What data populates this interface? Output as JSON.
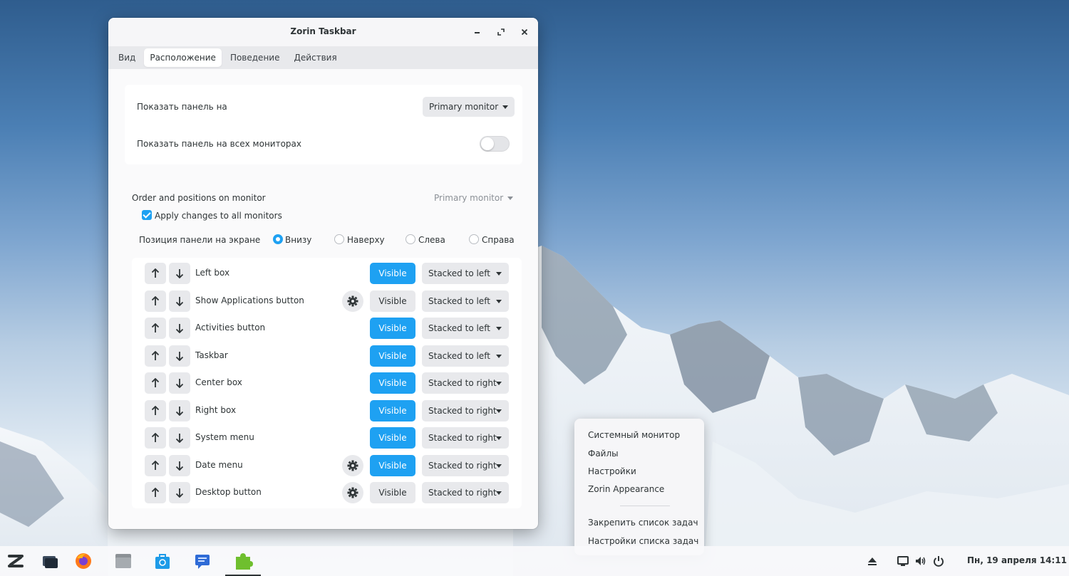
{
  "window": {
    "title": "Zorin Taskbar",
    "controls": [
      "minimize",
      "maximize",
      "close"
    ],
    "tabs": [
      {
        "label": "Вид",
        "active": false
      },
      {
        "label": "Расположение",
        "active": true
      },
      {
        "label": "Поведение",
        "active": false
      },
      {
        "label": "Действия",
        "active": false
      }
    ]
  },
  "display": {
    "show_panel_label": "Показать панель на",
    "show_panel_value": "Primary monitor",
    "all_monitors_label": "Показать панель на всех мониторах",
    "all_monitors_on": false
  },
  "order": {
    "heading": "Order and positions on monitor",
    "monitor_value": "Primary monitor",
    "apply_all_label": "Apply changes to all monitors",
    "apply_all_checked": true,
    "position_label": "Позиция панели на экране",
    "positions": [
      {
        "label": "Внизу",
        "selected": true
      },
      {
        "label": "Наверху",
        "selected": false
      },
      {
        "label": "Слева",
        "selected": false
      },
      {
        "label": "Справа",
        "selected": false
      }
    ]
  },
  "elements": [
    {
      "name": "Left box",
      "settings": false,
      "visible_label": "Visible",
      "visible": true,
      "stack": "Stacked to left"
    },
    {
      "name": "Show Applications button",
      "settings": true,
      "visible_label": "Visible",
      "visible": false,
      "stack": "Stacked to left"
    },
    {
      "name": "Activities button",
      "settings": false,
      "visible_label": "Visible",
      "visible": true,
      "stack": "Stacked to left"
    },
    {
      "name": "Taskbar",
      "settings": false,
      "visible_label": "Visible",
      "visible": true,
      "stack": "Stacked to left"
    },
    {
      "name": "Center box",
      "settings": false,
      "visible_label": "Visible",
      "visible": true,
      "stack": "Stacked to right"
    },
    {
      "name": "Right box",
      "settings": false,
      "visible_label": "Visible",
      "visible": true,
      "stack": "Stacked to right"
    },
    {
      "name": "System menu",
      "settings": false,
      "visible_label": "Visible",
      "visible": true,
      "stack": "Stacked to right"
    },
    {
      "name": "Date menu",
      "settings": true,
      "visible_label": "Visible",
      "visible": true,
      "stack": "Stacked to right"
    },
    {
      "name": "Desktop button",
      "settings": true,
      "visible_label": "Visible",
      "visible": false,
      "stack": "Stacked to right"
    }
  ],
  "context_menu": {
    "items": [
      "Системный монитор",
      "Файлы",
      "Настройки",
      "Zorin Appearance"
    ],
    "items2": [
      "Закрепить список задач",
      "Настройки списка задач"
    ]
  },
  "taskbar": {
    "apps": [
      "zorin-menu-icon",
      "workspaces-icon",
      "firefox-icon",
      "files-icon",
      "software-store-icon",
      "chat-icon",
      "extensions-icon"
    ],
    "tray": [
      "eject-icon",
      "screen-icon",
      "volume-icon",
      "power-icon"
    ],
    "clock": "Пн, 19 апреля  14:11"
  },
  "colors": {
    "accent": "#1ea1f2",
    "text": "#2e3436"
  }
}
